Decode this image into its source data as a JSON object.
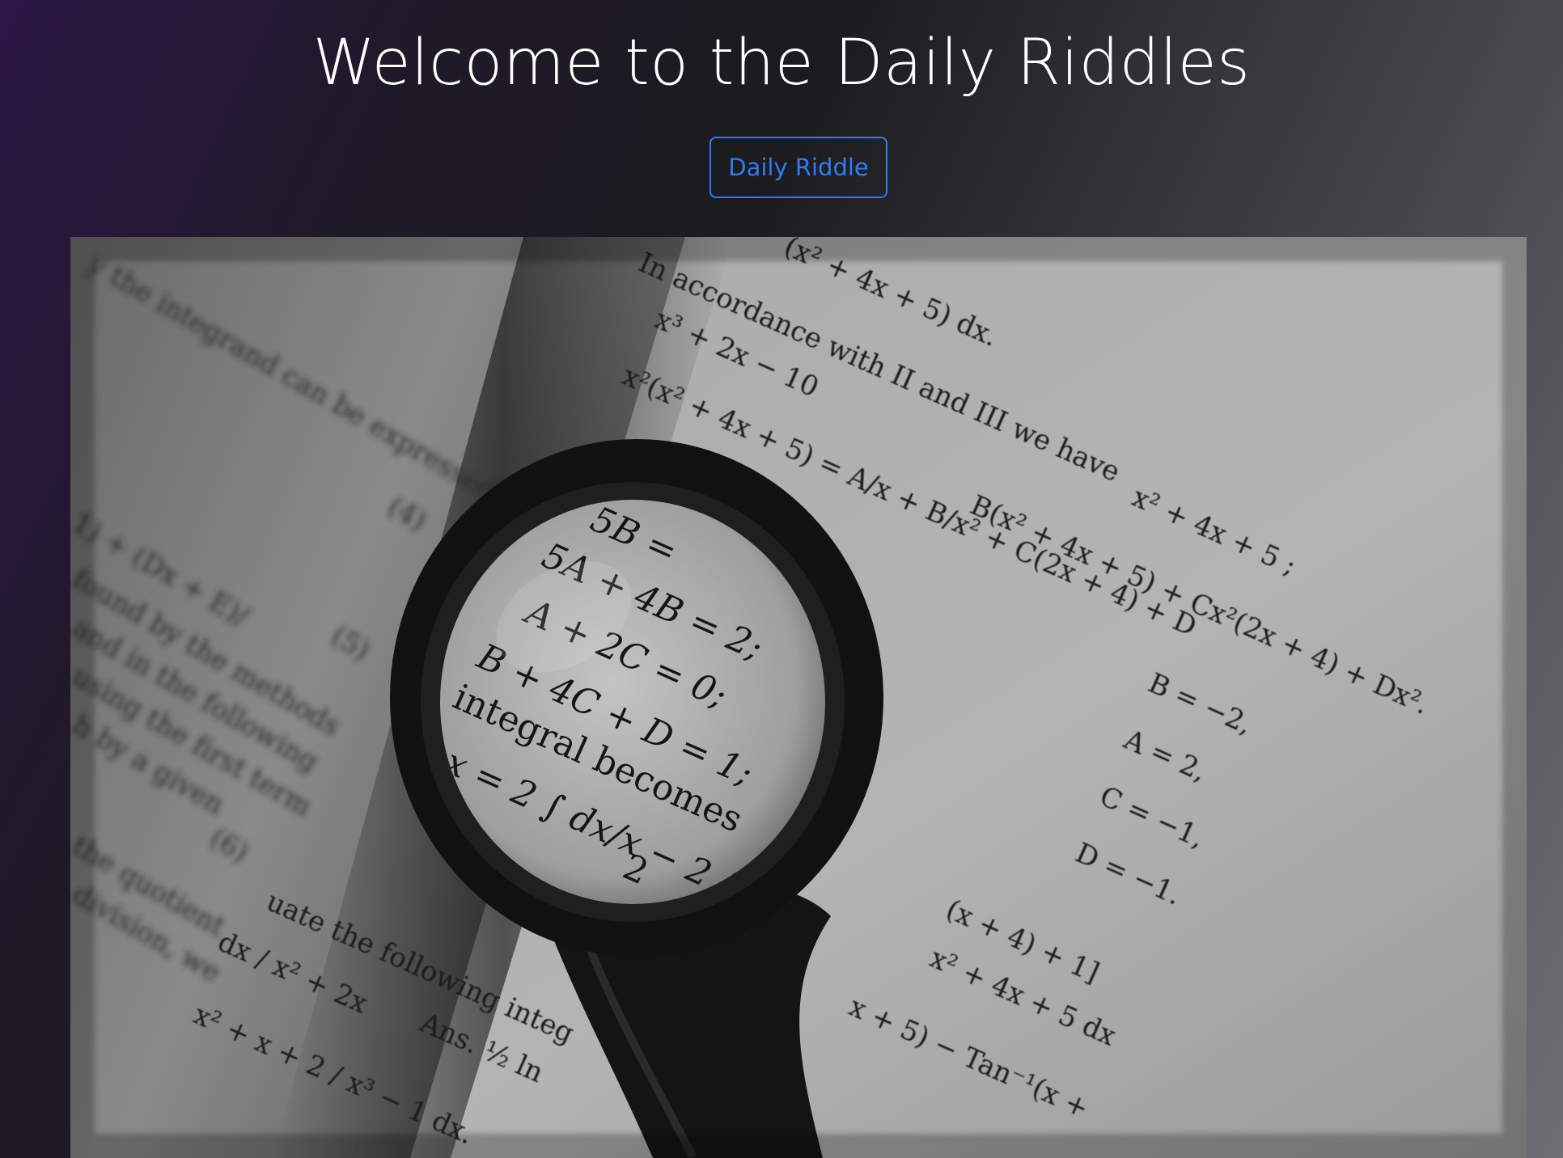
{
  "header": {
    "title": "Welcome to the Daily Riddles",
    "button_label": "Daily Riddle"
  },
  "hero_image": {
    "alt": "Magnifying glass on an open math textbook",
    "page_lines": [
      "In accordance with II and III we have",
      "5A + 4B = 2;",
      "A + 2C = 0;",
      "B + 4C + D = 1;",
      "integral becomes",
      "B = −2,",
      "A = 2,",
      "C = −1,",
      "D = −1.",
      "found by the methods",
      "and in the following",
      "using the first term",
      "the quotient",
      "division, we",
      "uate the following integ",
      "Ans.",
      "x + 5) − Tan⁻¹(x +"
    ]
  },
  "colors": {
    "accent": "#2f7cf0",
    "title_text": "#ffffff"
  }
}
